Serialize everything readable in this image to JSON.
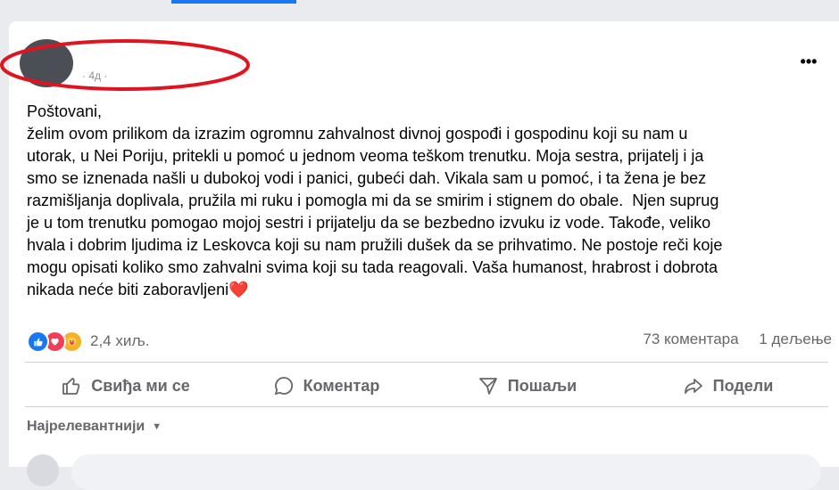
{
  "post": {
    "more_label": "•••",
    "meta_fragment": "· 4д ·",
    "text": "Poštovani,\nželim ovom prilikom da izrazim ogromnu zahvalnost divnoj gospođi i gospodinu koji su nam u\nutorak, u Nei Poriju, pritekli u pomoć u jednom veoma teškom trenutku. Moja sestra, prijatelj i ja\nsmo se iznenada našli u dubokoj vodi i panici, gubeći dah. Vikala sam u pomoć, i ta žena je bez\nrazmišljanja doplivala, pružila mi ruku i pomogla mi da se smirim i stignem do obale.  Njen suprug\nje u tom trenutku pomogao mojoj sestri i prijatelju da se bezbedno izvuku iz vode. Takođe, veliko\nhvala i dobrim ljudima iz Leskovca koji su nam pružili dušek da se prihvatimo. Ne postoje reči koje\nmogu opisati koliko smo zahvalni svima koji su tada reagovali. Vaša humanost, hrabrost i dobrota\nnikada neće biti zaboravljeni❤️"
  },
  "reactions": {
    "icons": [
      "like-icon",
      "love-icon",
      "care-icon"
    ],
    "count": "2,4 хиљ.",
    "comments": "73 коментара",
    "shares": "1 дељење"
  },
  "actions": {
    "like": "Свиђа ми се",
    "comment": "Коментар",
    "send": "Пошаљи",
    "share": "Подели"
  },
  "comments_sort": "Најрелевантнији",
  "colors": {
    "accent": "#1877f2",
    "love": "#f33e58",
    "care": "#f7b125",
    "redaction_oval": "#e0141e"
  }
}
